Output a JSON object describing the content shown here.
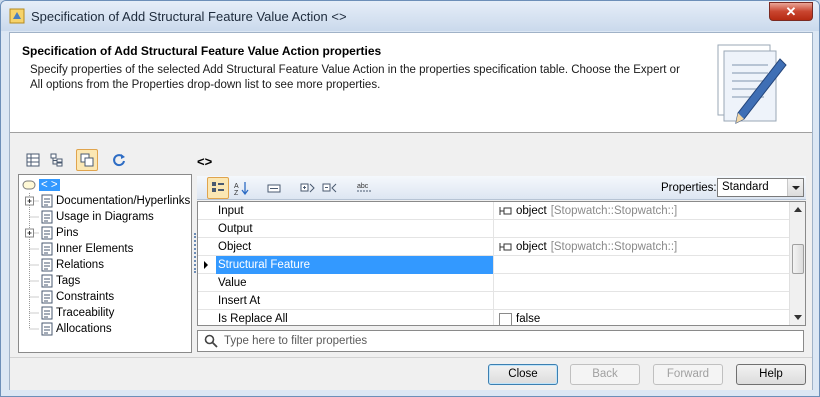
{
  "window": {
    "title": "Specification of Add Structural Feature Value Action <>"
  },
  "header": {
    "title": "Specification of Add Structural Feature Value Action properties",
    "description": "Specify properties of the selected Add Structural Feature Value Action in the properties specification table. Choose the Expert or All options from the Properties drop-down list to see more properties."
  },
  "element_title": "<>",
  "tree": {
    "root_label": "< >",
    "items": [
      {
        "label": "Documentation/Hyperlinks",
        "expandable": true
      },
      {
        "label": "Usage in Diagrams",
        "expandable": false
      },
      {
        "label": "Pins",
        "expandable": true
      },
      {
        "label": "Inner Elements",
        "expandable": false
      },
      {
        "label": "Relations",
        "expandable": false
      },
      {
        "label": "Tags",
        "expandable": false
      },
      {
        "label": "Constraints",
        "expandable": false
      },
      {
        "label": "Traceability",
        "expandable": false
      },
      {
        "label": "Allocations",
        "expandable": false
      }
    ]
  },
  "toolbar": {
    "properties_label": "Properties:",
    "properties_value": "Standard"
  },
  "properties": [
    {
      "name": "Input",
      "value": "object",
      "type": "[Stopwatch::Stopwatch::]"
    },
    {
      "name": "Output",
      "value": "",
      "type": ""
    },
    {
      "name": "Object",
      "value": "object",
      "type": "[Stopwatch::Stopwatch::]"
    },
    {
      "name": "Structural Feature",
      "value": "",
      "type": "",
      "selected": true
    },
    {
      "name": "Value",
      "value": "",
      "type": ""
    },
    {
      "name": "Insert At",
      "value": "",
      "type": ""
    },
    {
      "name": "Is Replace All",
      "value": "false",
      "type": ""
    }
  ],
  "filter": {
    "placeholder": "Type here to filter properties"
  },
  "buttons": {
    "close": "Close",
    "back": "Back",
    "forward": "Forward",
    "help": "Help"
  },
  "colors": {
    "selection": "#3399ff",
    "accent": "#e0a44d"
  }
}
